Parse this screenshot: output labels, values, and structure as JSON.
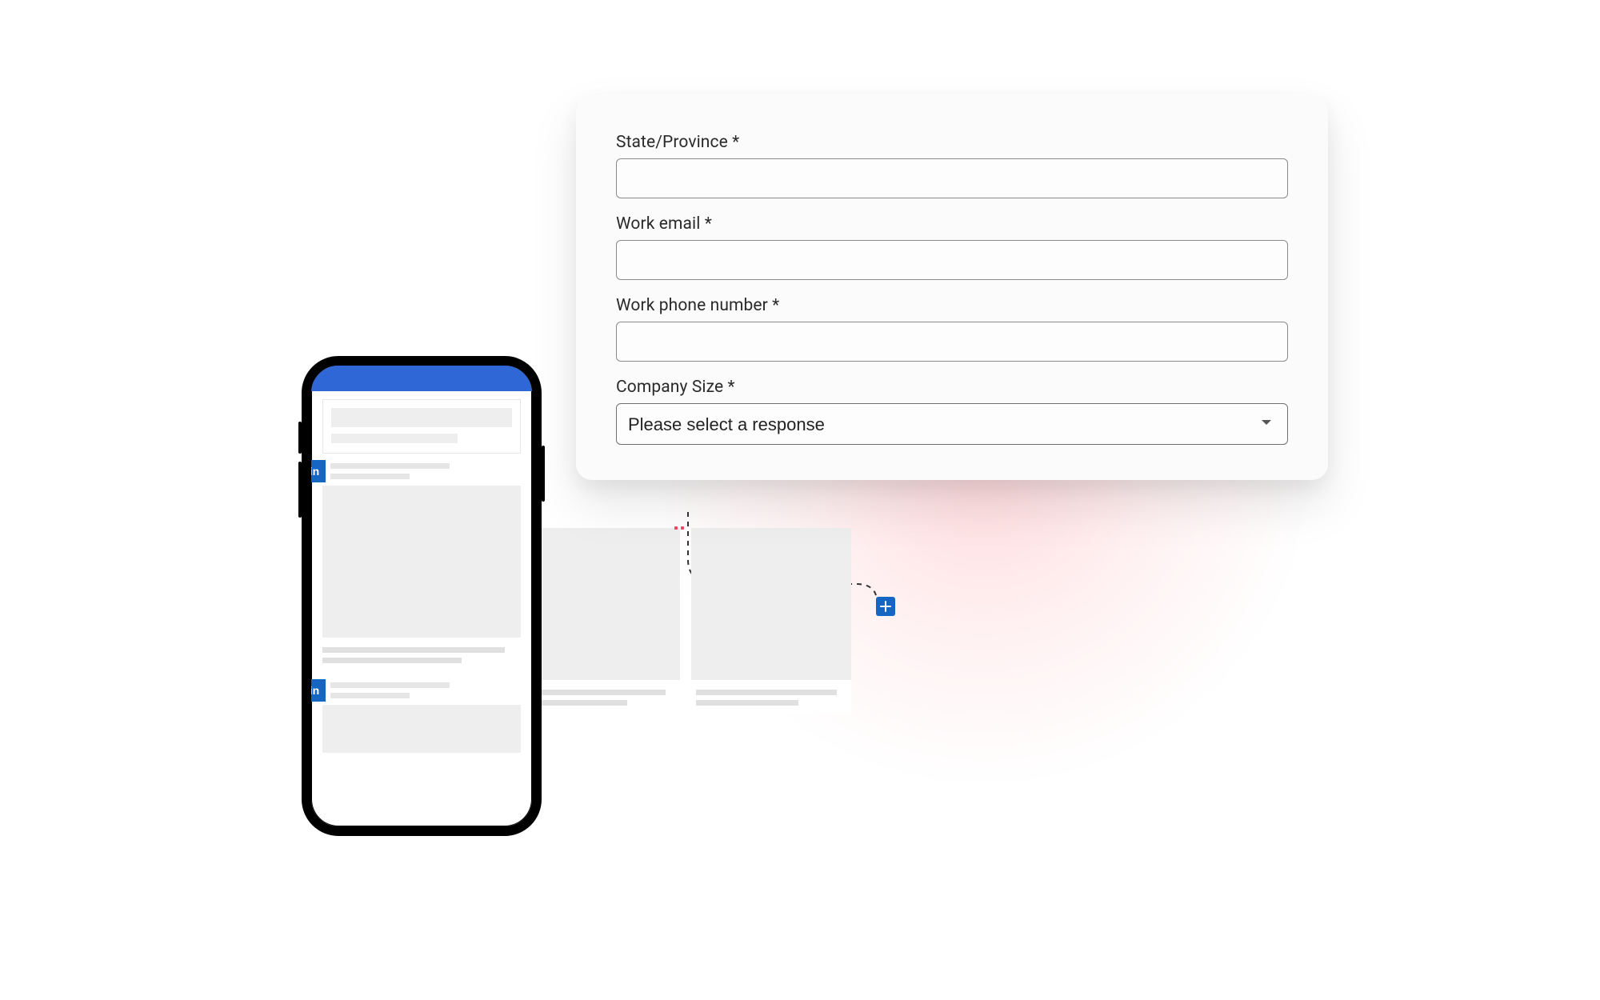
{
  "form": {
    "fields": {
      "state": {
        "label": "State/Province *",
        "value": ""
      },
      "email": {
        "label": "Work email *",
        "value": ""
      },
      "phone": {
        "label": "Work phone number *",
        "value": ""
      },
      "company_size": {
        "label": "Company Size *",
        "placeholder": "Please select a response"
      }
    }
  },
  "phone_mock": {
    "brand_icon": "in",
    "status_bar_color": "#2f68d6"
  },
  "builder": {
    "add_step_icon": "plus-icon"
  },
  "colors": {
    "brand_blue": "#1566c2",
    "glow_pink": "rgba(255,120,130,0.25)"
  }
}
